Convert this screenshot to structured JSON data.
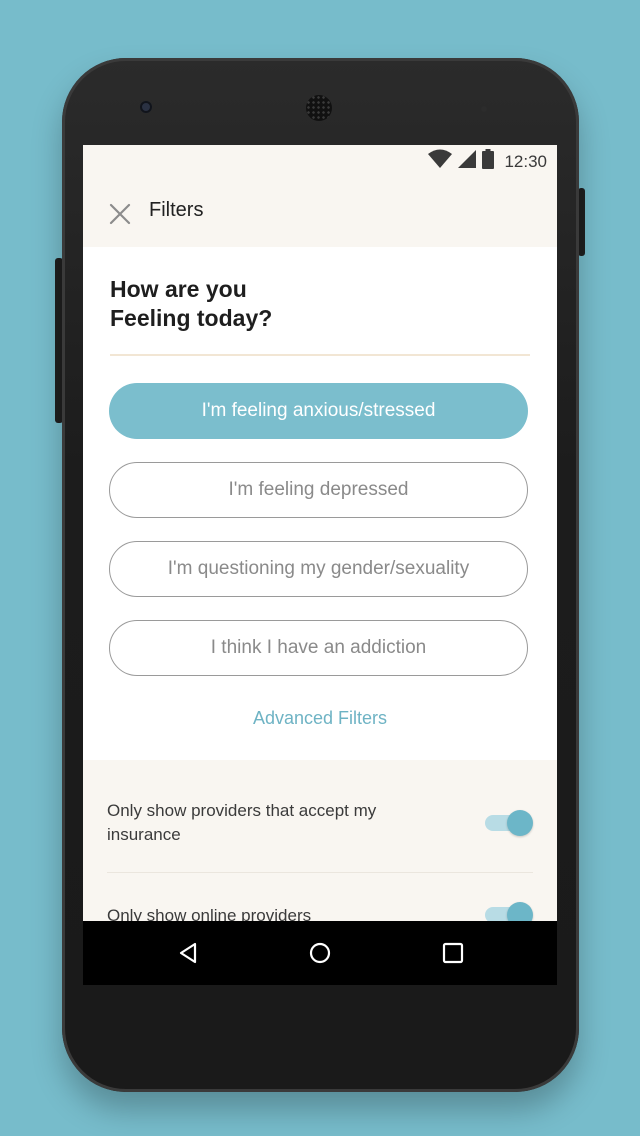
{
  "status": {
    "time": "12:30",
    "icons": [
      "wifi-icon",
      "cell-signal-icon",
      "battery-icon"
    ]
  },
  "header": {
    "title": "Filters",
    "close_icon": "close-icon"
  },
  "question": {
    "line1": "How are you",
    "line2": "Feeling today?"
  },
  "options": [
    {
      "label": "I'm feeling anxious/stressed",
      "selected": true
    },
    {
      "label": "I'm feeling depressed",
      "selected": false
    },
    {
      "label": "I'm questioning my gender/sexuality",
      "selected": false
    },
    {
      "label": "I think I have an addiction",
      "selected": false
    }
  ],
  "advanced_filters_label": "Advanced Filters",
  "settings": [
    {
      "label": "Only show providers that accept my insurance",
      "enabled": true
    },
    {
      "label": "Only show online providers",
      "enabled": true
    }
  ],
  "nav": {
    "back": "back-icon",
    "home": "home-icon",
    "recents": "recents-icon"
  },
  "colors": {
    "background": "#77bccb",
    "accent": "#7bbecd",
    "link": "#6eb3c4",
    "panel": "#f9f6f1"
  }
}
